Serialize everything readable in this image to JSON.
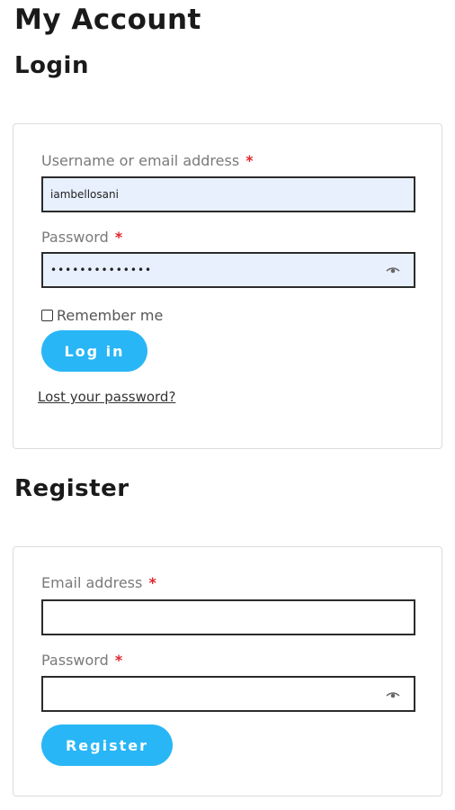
{
  "page": {
    "title": "My Account"
  },
  "login": {
    "heading": "Login",
    "username": {
      "label": "Username or email address",
      "required_mark": "*",
      "value": "iambellosani"
    },
    "password": {
      "label": "Password",
      "required_mark": "*",
      "value": "••••••••••••••",
      "eye_icon": "eye-icon"
    },
    "remember": {
      "label": "Remember me",
      "checked": false
    },
    "submit_label": "Log in",
    "lost_password_label": "Lost your password?"
  },
  "register": {
    "heading": "Register",
    "email": {
      "label": "Email address",
      "required_mark": "*",
      "value": ""
    },
    "password": {
      "label": "Password",
      "required_mark": "*",
      "value": "",
      "eye_icon": "eye-icon"
    },
    "submit_label": "Register"
  },
  "colors": {
    "accent": "#28b6f6",
    "required": "#e2252b",
    "autofill_bg": "#e8f0fe",
    "label": "#7a7a7a",
    "card_border": "#dcdcdc"
  }
}
